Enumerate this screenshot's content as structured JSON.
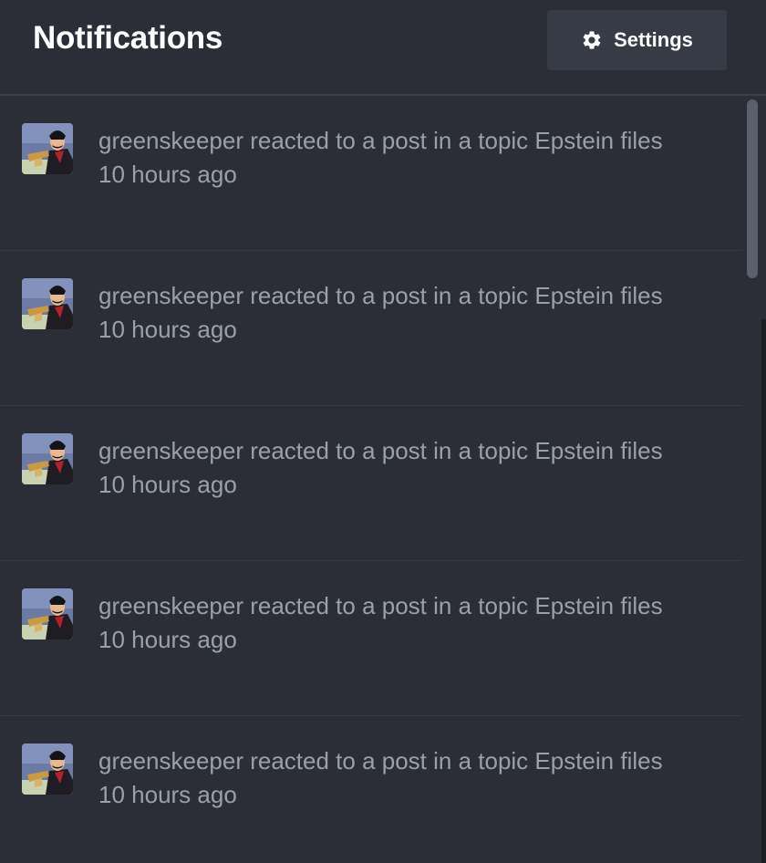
{
  "header": {
    "title": "Notifications",
    "settings_label": "Settings",
    "settings_icon": "gear-icon"
  },
  "notifications": [
    {
      "user": "greenskeeper",
      "message": "greenskeeper reacted to a post in a topic Epstein files",
      "time": "10 hours ago"
    },
    {
      "user": "greenskeeper",
      "message": "greenskeeper reacted to a post in a topic Epstein files",
      "time": "10 hours ago"
    },
    {
      "user": "greenskeeper",
      "message": "greenskeeper reacted to a post in a topic Epstein files",
      "time": "10 hours ago"
    },
    {
      "user": "greenskeeper",
      "message": "greenskeeper reacted to a post in a topic Epstein files",
      "time": "10 hours ago"
    },
    {
      "user": "greenskeeper",
      "message": "greenskeeper reacted to a post in a topic Epstein files",
      "time": "10 hours ago"
    }
  ],
  "colors": {
    "background": "#2b2e36",
    "button_bg": "#363b46",
    "muted_text": "#9aa0ab",
    "title_text": "#ffffff"
  }
}
